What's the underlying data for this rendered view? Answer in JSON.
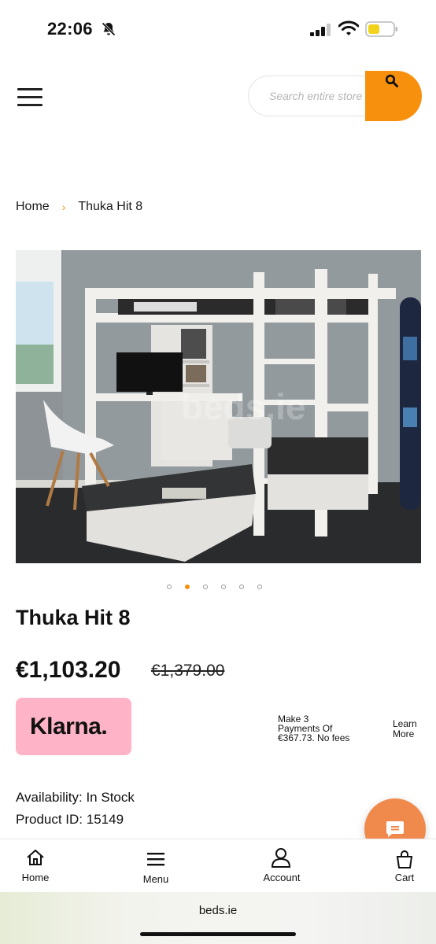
{
  "status_bar": {
    "time": "22:06"
  },
  "header": {
    "search_placeholder": "Search entire store here..."
  },
  "breadcrumb": {
    "home": "Home",
    "separator": "›",
    "current": "Thuka Hit 8"
  },
  "gallery": {
    "watermark": "beds.ie",
    "total_images": 6,
    "active_index": 1
  },
  "product": {
    "title": "Thuka Hit 8",
    "price": "€1,103.20",
    "old_price": "€1,379.00",
    "availability": "Availability: In Stock",
    "product_id": "Product ID: 15149"
  },
  "klarna": {
    "logo": "Klarna.",
    "text_line1": "Make 3",
    "text_line2": "Payments Of",
    "text_line3": "€367.73. No fees",
    "learn_line1": "Learn",
    "learn_line2": "More"
  },
  "bottom_nav": {
    "items": [
      {
        "label": "Home",
        "icon": "home-icon"
      },
      {
        "label": "Menu",
        "icon": "menu-icon"
      },
      {
        "label": "Account",
        "icon": "user-icon"
      },
      {
        "label": "Cart",
        "icon": "cart-icon"
      }
    ]
  },
  "browser": {
    "url": "beds.ie"
  },
  "colors": {
    "accent": "#f7900d",
    "klarna_pink": "#ffb3c7",
    "chat": "#f08a4c"
  }
}
